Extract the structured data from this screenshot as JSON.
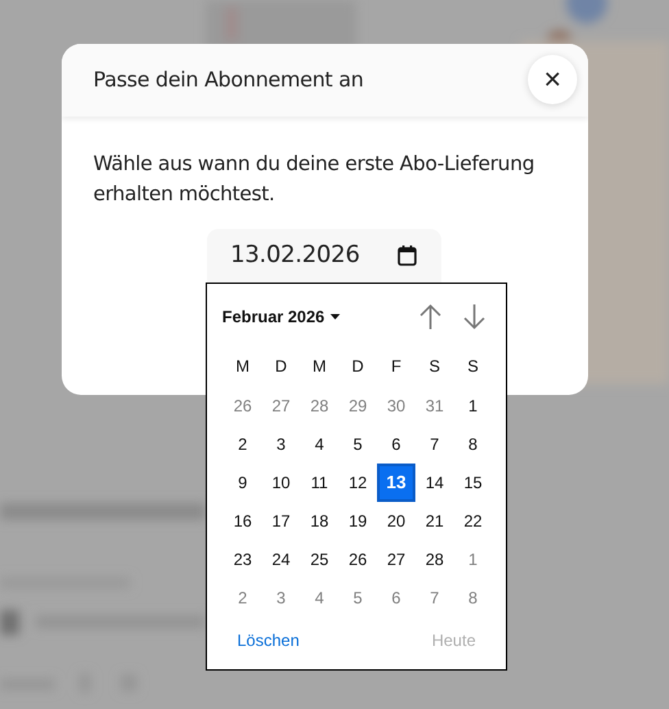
{
  "dialog": {
    "title": "Passe dein Abonnement an",
    "close": "×",
    "message": "Wähle aus wann du deine erste Abo-Lieferung erhalten möchtest.",
    "date_field": {
      "value": "13.02.2026"
    }
  },
  "calendar": {
    "month_label": "Februar 2026",
    "weekdays": [
      "M",
      "D",
      "M",
      "D",
      "F",
      "S",
      "S"
    ],
    "days": [
      {
        "label": "26",
        "in_month": false,
        "selected": false
      },
      {
        "label": "27",
        "in_month": false,
        "selected": false
      },
      {
        "label": "28",
        "in_month": false,
        "selected": false
      },
      {
        "label": "29",
        "in_month": false,
        "selected": false
      },
      {
        "label": "30",
        "in_month": false,
        "selected": false
      },
      {
        "label": "31",
        "in_month": false,
        "selected": false
      },
      {
        "label": "1",
        "in_month": true,
        "selected": false
      },
      {
        "label": "2",
        "in_month": true,
        "selected": false
      },
      {
        "label": "3",
        "in_month": true,
        "selected": false
      },
      {
        "label": "4",
        "in_month": true,
        "selected": false
      },
      {
        "label": "5",
        "in_month": true,
        "selected": false
      },
      {
        "label": "6",
        "in_month": true,
        "selected": false
      },
      {
        "label": "7",
        "in_month": true,
        "selected": false
      },
      {
        "label": "8",
        "in_month": true,
        "selected": false
      },
      {
        "label": "9",
        "in_month": true,
        "selected": false
      },
      {
        "label": "10",
        "in_month": true,
        "selected": false
      },
      {
        "label": "11",
        "in_month": true,
        "selected": false
      },
      {
        "label": "12",
        "in_month": true,
        "selected": false
      },
      {
        "label": "13",
        "in_month": true,
        "selected": true
      },
      {
        "label": "14",
        "in_month": true,
        "selected": false
      },
      {
        "label": "15",
        "in_month": true,
        "selected": false
      },
      {
        "label": "16",
        "in_month": true,
        "selected": false
      },
      {
        "label": "17",
        "in_month": true,
        "selected": false
      },
      {
        "label": "18",
        "in_month": true,
        "selected": false
      },
      {
        "label": "19",
        "in_month": true,
        "selected": false
      },
      {
        "label": "20",
        "in_month": true,
        "selected": false
      },
      {
        "label": "21",
        "in_month": true,
        "selected": false
      },
      {
        "label": "22",
        "in_month": true,
        "selected": false
      },
      {
        "label": "23",
        "in_month": true,
        "selected": false
      },
      {
        "label": "24",
        "in_month": true,
        "selected": false
      },
      {
        "label": "25",
        "in_month": true,
        "selected": false
      },
      {
        "label": "26",
        "in_month": true,
        "selected": false
      },
      {
        "label": "27",
        "in_month": true,
        "selected": false
      },
      {
        "label": "28",
        "in_month": true,
        "selected": false
      },
      {
        "label": "1",
        "in_month": false,
        "selected": false
      },
      {
        "label": "2",
        "in_month": false,
        "selected": false
      },
      {
        "label": "3",
        "in_month": false,
        "selected": false
      },
      {
        "label": "4",
        "in_month": false,
        "selected": false
      },
      {
        "label": "5",
        "in_month": false,
        "selected": false
      },
      {
        "label": "6",
        "in_month": false,
        "selected": false
      },
      {
        "label": "7",
        "in_month": false,
        "selected": false
      },
      {
        "label": "8",
        "in_month": false,
        "selected": false
      }
    ],
    "clear": {
      "label": "Löschen",
      "disabled": false
    },
    "today": {
      "label": "Heute",
      "disabled": true
    }
  }
}
